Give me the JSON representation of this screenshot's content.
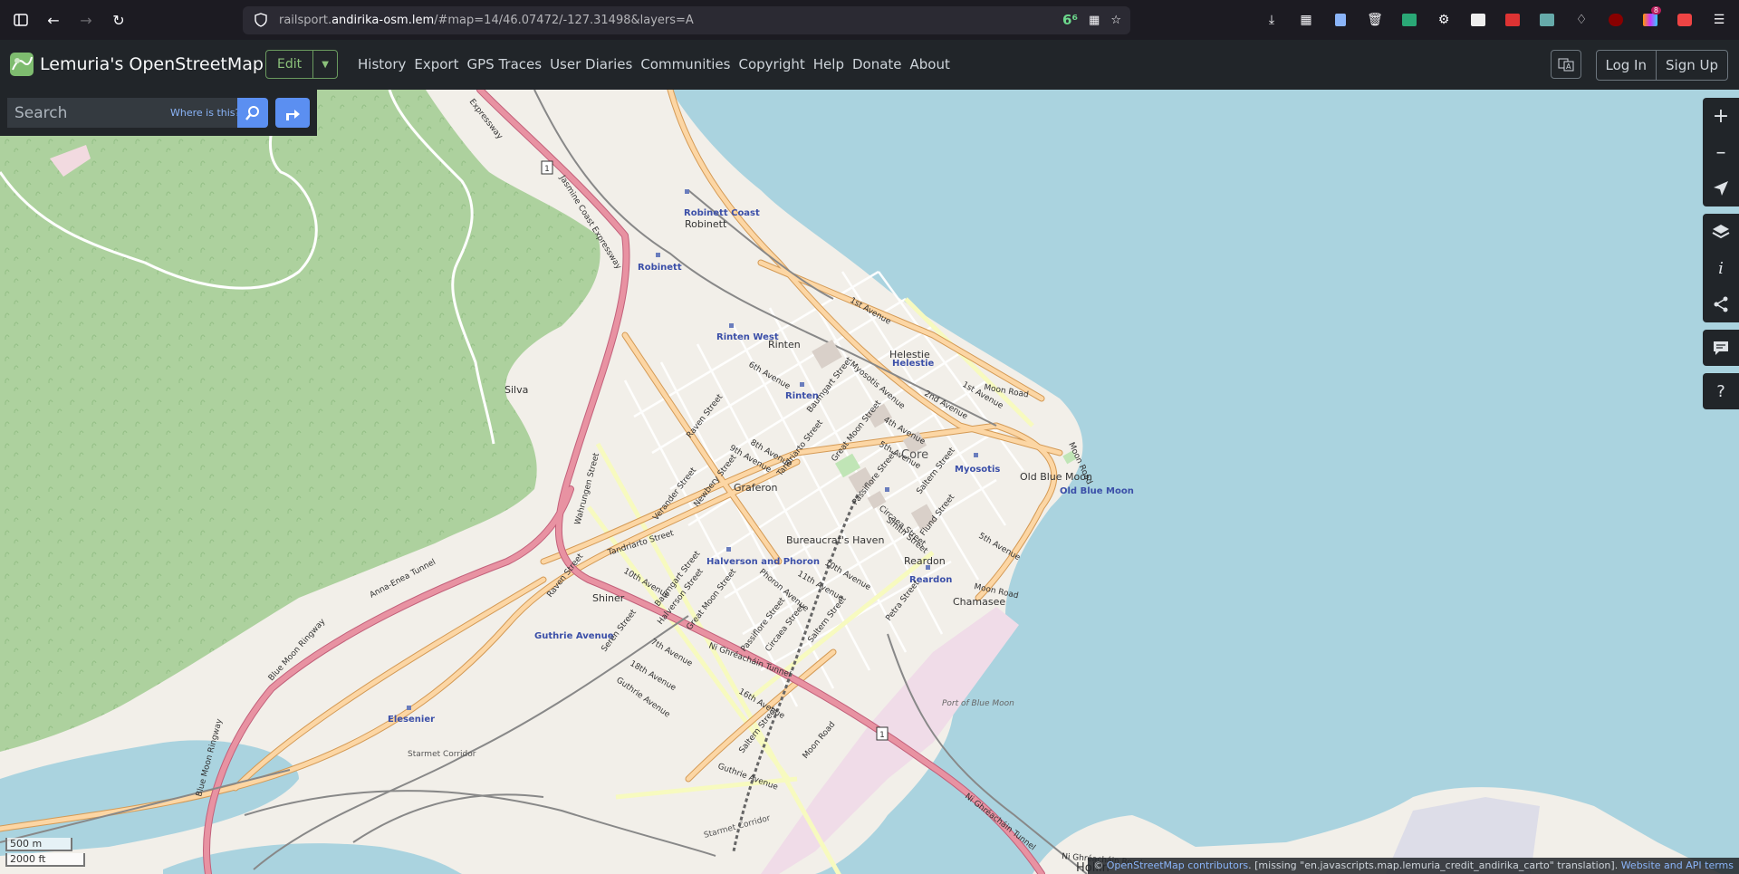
{
  "browser": {
    "url_prefix": "railsport.",
    "url_host": "andirika-osm.lem",
    "url_suffix": "/#map=14/46.07472/-127.31498&layers=A",
    "badge": "6⁶"
  },
  "header": {
    "site_title": "Lemuria's OpenStreetMap",
    "edit_label": "Edit",
    "nav": [
      "History",
      "Export",
      "GPS Traces",
      "User Diaries",
      "Communities",
      "Copyright",
      "Help",
      "Donate",
      "About"
    ],
    "login": "Log In",
    "signup": "Sign Up"
  },
  "search": {
    "placeholder": "Search",
    "where_is_this": "Where is this?"
  },
  "map": {
    "labels": {
      "silva": "Silva",
      "robinett_coast": "Robinett Coast",
      "robinett": "Robinett",
      "robinett_station": "Robinett",
      "rinten_west": "Rinten West",
      "rinten": "Rinten",
      "rinten_station": "Rinten",
      "helestie": "Helestie",
      "helestie_station": "Helestie",
      "core": "Core",
      "myosotis": "Myosotis",
      "old_blue_moon": "Old Blue Moon",
      "old_blue_moon_station": "Old Blue Moon",
      "graferon": "Graferon",
      "bureaucrats_haven": "Bureaucrat's Haven",
      "halverson_phoron": "Halverson and Phoron",
      "reardon": "Reardon",
      "reardon_station": "Reardon",
      "chamasee": "Chamasee",
      "shiner": "Shiner",
      "guthrie_avenue": "Guthrie Avenue",
      "elesenier": "Elesenier",
      "port_of_blue_moon": "Port of Blue Moon",
      "hollin": "Hollin",
      "jasmine_coast_expressway": "Jasmine Coast Expressway",
      "expressway": "Expressway",
      "anna_enea_tunnel": "Anna-Enea Tunnel",
      "blue_moon_ringway": "Blue Moon Ringway",
      "blue_moon_ringway_2": "Blue Moon Ringway",
      "starmet_corridor": "Starmet Corridor",
      "starmet_corridor_2": "Starmet Corridor",
      "ni_ghreachain_tunnel": "Ni Ghréacháin Tunnel",
      "ni_ghreachain_tunnel_2": "Ni Ghréacháin Tunnel",
      "ni_ghreachain_road": "Ni Ghréacháin Road",
      "first_avenue": "1st Avenue",
      "first_avenue_2": "1st Avenue",
      "second_avenue": "2nd Avenue",
      "fourth_avenue": "4th Avenue",
      "fifth_avenue": "5th Avenue",
      "fifth_avenue_2": "5th Avenue",
      "sixth_avenue": "6th Avenue",
      "seventh_avenue": "7th Avenue",
      "eighth_avenue": "8th Avenue",
      "ninth_avenue": "9th Avenue",
      "tenth_avenue": "10th Avenue",
      "tenth_avenue_2": "10th Avenue",
      "eleventh_avenue": "11th Avenue",
      "sixteenth_avenue": "16th Avenue",
      "eighteenth_avenue": "18th Avenue",
      "moon_road": "Moon Road",
      "moon_road_2": "Moon Road",
      "moon_road_3": "Moon Road",
      "moon_road_4": "Moon Road",
      "myosotis_avenue": "Myosotis Avenue",
      "great_moon_street": "Great Moon Street",
      "great_moon_street_2": "Great Moon Street",
      "baumgart_street": "Baumgart Street",
      "baumgart_street_2": "Baumgart Street",
      "tandriarto_street": "Tandriarto Street",
      "tandriarto_street_2": "Tandriarto Street",
      "raven_street": "Raven Street",
      "raven_street_2": "Raven Street",
      "verander_street": "Verander Street",
      "newbery_street": "Newbery Street",
      "wahrungen_street": "Wahrungen Street",
      "passiflore_street": "Passiflore Street",
      "passiflore_street_2": "Passiflore Street",
      "circaea_street": "Circaea Street",
      "circaea_street_2": "Circaea Street",
      "saltern_street": "Saltern Street",
      "saltern_street_2": "Saltern Street",
      "saltern_street_3": "Saltern Street",
      "smith_street": "Smith Street",
      "flund_street": "Flund Street",
      "petra_street": "Petra Street",
      "phoron_avenue": "Phoron Avenue",
      "halverson_street": "Halverson Street",
      "seren_street": "Seren Street",
      "guthrie_avenue_road": "Guthrie Avenue",
      "guthrie_avenue_road_2": "Guthrie Avenue",
      "route_1": "1",
      "route_1b": "1"
    }
  },
  "scale": {
    "metric": "500 m",
    "imperial": "2000 ft"
  },
  "attribution": {
    "prefix": "© ",
    "osm_link": "OpenStreetMap contributors",
    "missing": ". [missing \"en.javascripts.map.lemuria_credit_andirika_carto\" translation]. ",
    "terms_link": "Website and API terms"
  },
  "colors": {
    "water": "#aad3df",
    "land": "#f2efe9",
    "forest": "#add19e",
    "motorway": "#e892a2",
    "primary": "#fcd6a4",
    "secondary": "#f7fabf",
    "link": "#5b8ff1"
  }
}
